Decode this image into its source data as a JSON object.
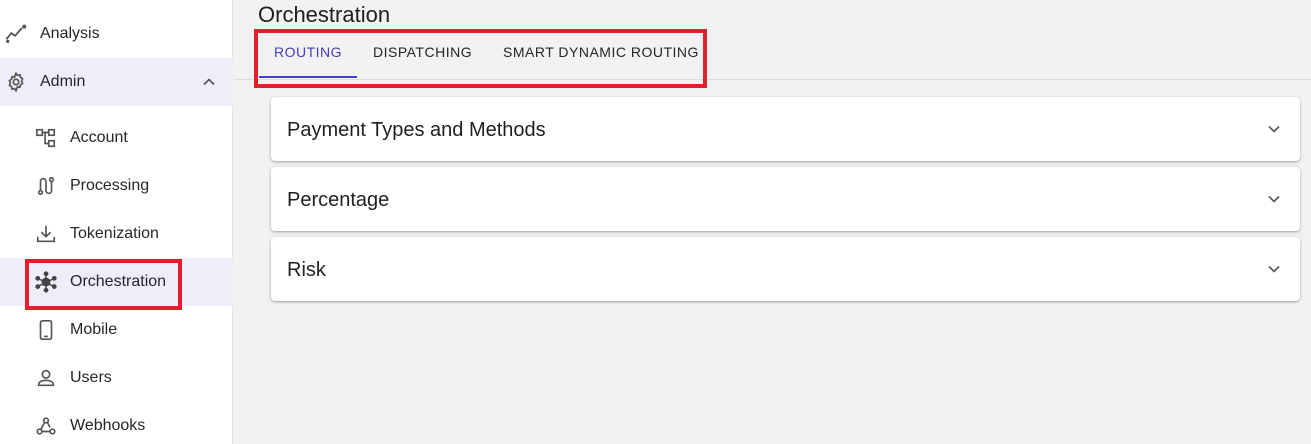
{
  "sidebar": {
    "analysis": {
      "label": "Analysis",
      "icon": "analysis-trend-icon"
    },
    "admin": {
      "label": "Admin",
      "icon": "gear-icon",
      "expanded": true
    },
    "items": [
      {
        "label": "Account",
        "icon": "account-tree-icon"
      },
      {
        "label": "Processing",
        "icon": "route-icon"
      },
      {
        "label": "Tokenization",
        "icon": "download-icon"
      },
      {
        "label": "Orchestration",
        "icon": "hub-icon",
        "selected": true
      },
      {
        "label": "Mobile",
        "icon": "phone-icon"
      },
      {
        "label": "Users",
        "icon": "person-icon"
      },
      {
        "label": "Webhooks",
        "icon": "webhook-icon"
      }
    ]
  },
  "main": {
    "title": "Orchestration",
    "tabs": [
      {
        "label": "ROUTING",
        "active": true
      },
      {
        "label": "DISPATCHING",
        "active": false
      },
      {
        "label": "SMART DYNAMIC ROUTING",
        "active": false
      }
    ],
    "panels": [
      {
        "title": "Payment Types and Methods"
      },
      {
        "title": "Percentage"
      },
      {
        "title": "Risk"
      }
    ]
  },
  "colors": {
    "accent": "#3f3fbf",
    "highlight": "#e0202c",
    "selected_bg": "#eeedf9",
    "background": "#f2f2f2"
  }
}
